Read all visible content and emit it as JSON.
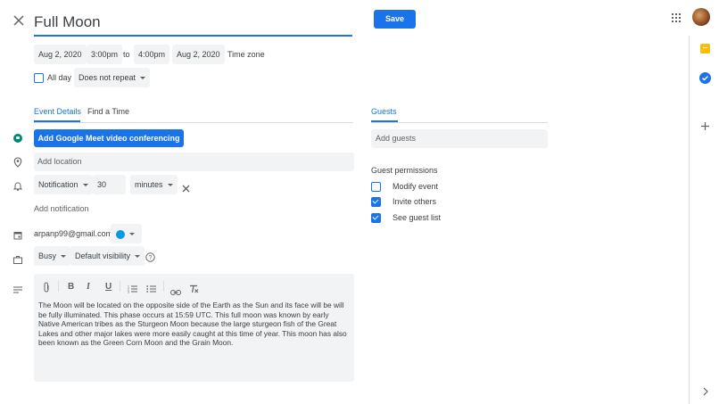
{
  "event": {
    "title": "Full Moon",
    "save_label": "Save"
  },
  "datetime": {
    "start_date": "Aug 2, 2020",
    "start_time": "3:00pm",
    "to_label": "to",
    "end_time": "4:00pm",
    "end_date": "Aug 2, 2020",
    "timezone_label": "Time zone"
  },
  "allday": {
    "label": "All day",
    "repeat": "Does not repeat"
  },
  "tabs": {
    "event_details": "Event Details",
    "find_time": "Find a Time",
    "guests": "Guests"
  },
  "details": {
    "meet_button": "Add Google Meet video conferencing",
    "location_placeholder": "Add location",
    "notification_type": "Notification",
    "notification_value": "30",
    "notification_unit": "minutes",
    "add_notification": "Add notification",
    "calendar_owner": "arpanp99@gmail.com",
    "calendar_color": "#039be5",
    "busy": "Busy",
    "visibility": "Default visibility",
    "description": "The Moon will be located on the opposite side of the Earth as the Sun and its face will be will be fully illuminated. This phase occurs at 15:59 UTC. This full moon was known by early Native American tribes as the Sturgeon Moon because the large sturgeon fish of the Great Lakes and other major lakes were more easily caught at this time of year. This moon has also been known as the Green Corn Moon and the Grain Moon."
  },
  "guests": {
    "add_placeholder": "Add guests",
    "permissions_label": "Guest permissions",
    "permissions": [
      {
        "label": "Modify event",
        "checked": false
      },
      {
        "label": "Invite others",
        "checked": true
      },
      {
        "label": "See guest list",
        "checked": true
      }
    ]
  },
  "colors": {
    "accent": "#1a73e8",
    "keep_yellow": "#fbbc04",
    "tasks_blue": "#1a73e8",
    "meet_green": "#00897b"
  }
}
